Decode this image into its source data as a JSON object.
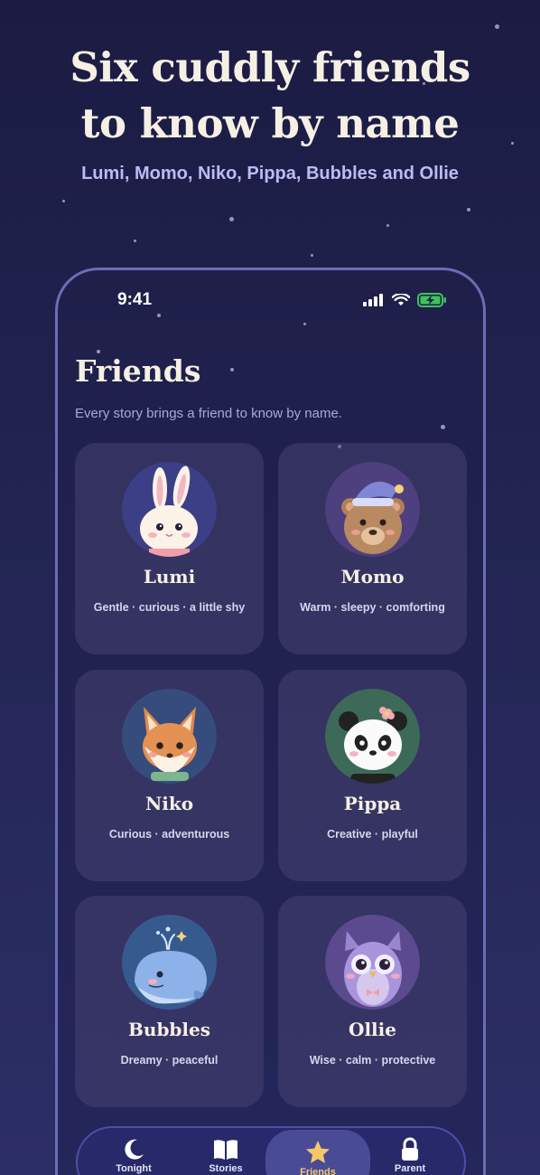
{
  "hero": {
    "title_line1": "Six cuddly friends",
    "title_line2": "to know by name",
    "subtitle": "Lumi, Momo, Niko, Pippa, Bubbles and Ollie"
  },
  "status_bar": {
    "time": "9:41"
  },
  "page": {
    "title": "Friends",
    "subtitle": "Every story brings a friend to know by name."
  },
  "friends": [
    {
      "name": "Lumi",
      "traits": "Gentle · curious · a little shy",
      "icon": "bunny-icon"
    },
    {
      "name": "Momo",
      "traits": "Warm · sleepy · comforting",
      "icon": "bear-icon"
    },
    {
      "name": "Niko",
      "traits": "Curious · adventurous",
      "icon": "fox-icon"
    },
    {
      "name": "Pippa",
      "traits": "Creative · playful",
      "icon": "panda-icon"
    },
    {
      "name": "Bubbles",
      "traits": "Dreamy · peaceful",
      "icon": "whale-icon"
    },
    {
      "name": "Ollie",
      "traits": "Wise · calm · protective",
      "icon": "owl-icon"
    }
  ],
  "tabs": [
    {
      "label": "Tonight",
      "icon": "moon-icon",
      "active": false
    },
    {
      "label": "Stories",
      "icon": "book-icon",
      "active": false
    },
    {
      "label": "Friends",
      "icon": "star-icon",
      "active": true
    },
    {
      "label": "Parent",
      "icon": "lock-icon",
      "active": false
    }
  ],
  "colors": {
    "background": "#1b1b43",
    "card": "#3a3766",
    "accent_active": "#f4c86a",
    "phone_frame": "#6c6db6"
  }
}
